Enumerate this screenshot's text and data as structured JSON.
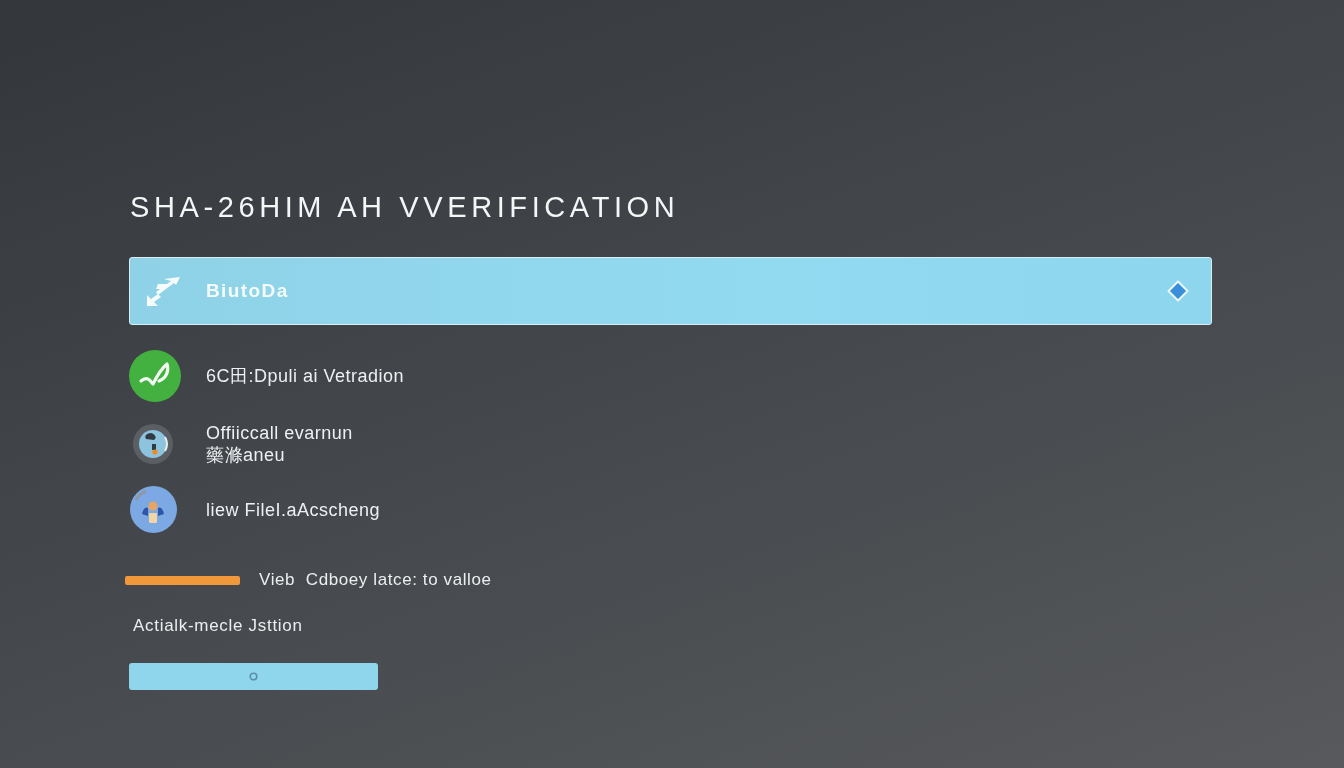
{
  "title": "SHA-26HIM AH VVERIFICATION",
  "banner": {
    "label": "BiutoDa"
  },
  "items": [
    {
      "kind": "check",
      "lines": [
        "6C田:Dpuli ai Vetradion"
      ]
    },
    {
      "kind": "dial",
      "lines": [
        "Offiiccall evarnun",
        "藥滌aneu"
      ]
    },
    {
      "kind": "figure",
      "lines": [
        "liew FileI.aAcscheng"
      ]
    }
  ],
  "note": "Vieb  Cdboey latce: to valloe",
  "caption": "Actialk-mecle Jsttion"
}
